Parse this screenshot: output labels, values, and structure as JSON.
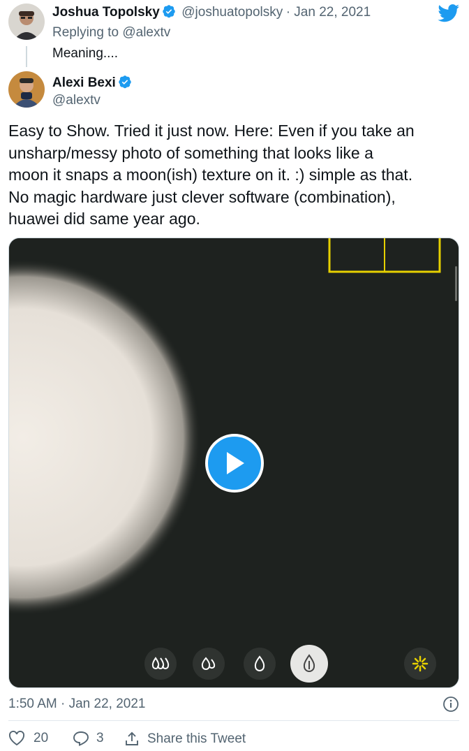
{
  "parent_tweet": {
    "author_name": "Joshua Topolsky",
    "author_handle": "@joshuatopolsky",
    "date": "· Jan 22, 2021",
    "replying_to": "Replying to @alextv",
    "text": "Meaning...."
  },
  "tweet": {
    "author_name": "Alexi Bexi",
    "author_handle": "@alextv",
    "text_lines": [
      "Easy to Show. Tried it just now. Here: Even if you take an",
      "unsharp/messy photo of something that looks like a",
      "moon it snaps a moon(ish) texture on it. :) simple as that.",
      "No magic hardware just clever software (combination),",
      "huawei did same year ago."
    ],
    "timestamp": "1:50 AM · Jan 22, 2021"
  },
  "actions": {
    "likes": "20",
    "replies": "3",
    "share_label": "Share this Tweet"
  },
  "colors": {
    "twitter_blue": "#1d9bf0",
    "text": "#0f1419",
    "muted": "#536471",
    "video_bg": "#1e221f",
    "focus_box": "#e6d000"
  },
  "icons": [
    "twitter-bird-icon",
    "verified-badge-icon",
    "play-icon",
    "info-icon",
    "heart-icon",
    "reply-icon",
    "share-icon"
  ]
}
